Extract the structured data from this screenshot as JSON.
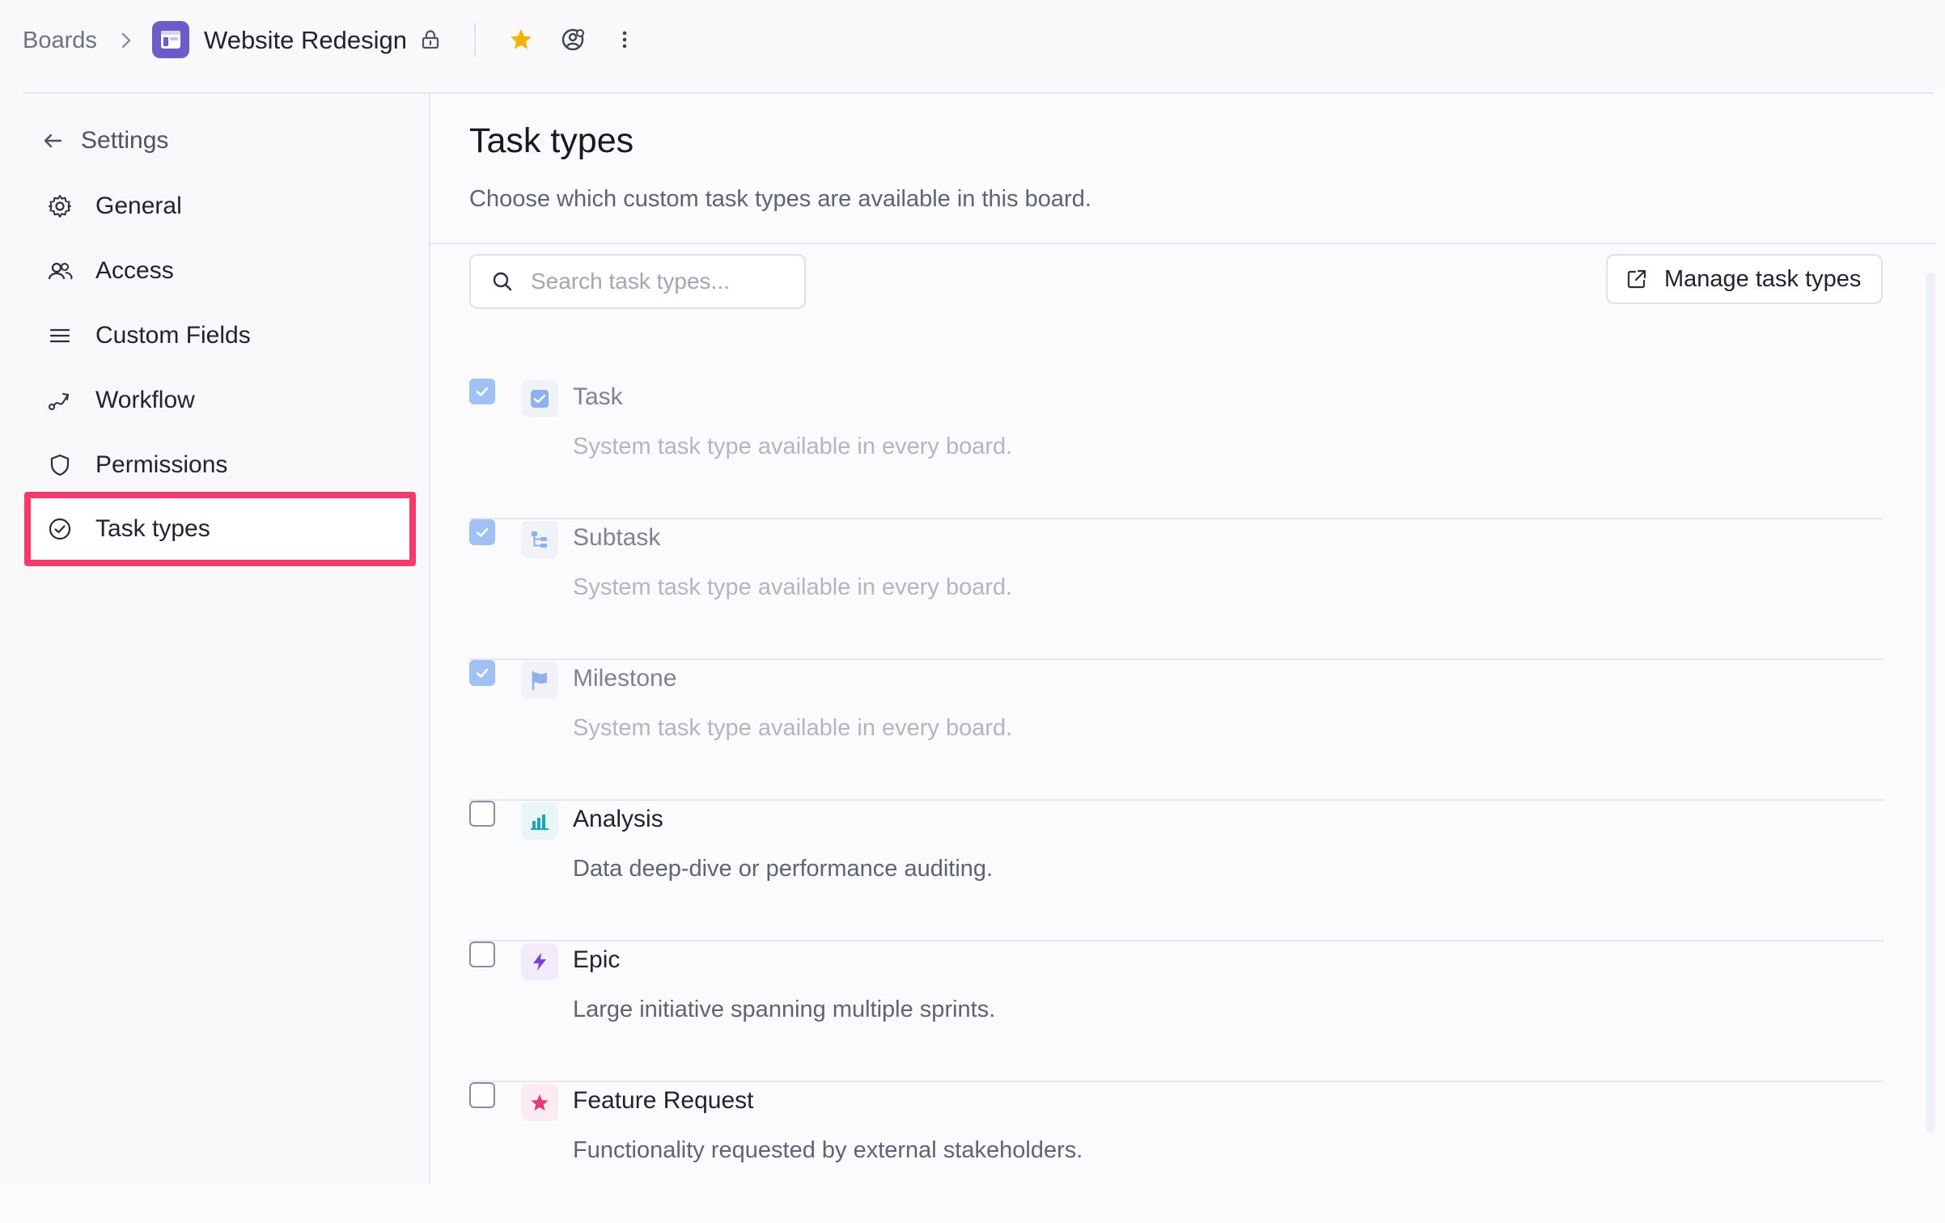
{
  "breadcrumb": {
    "root": "Boards",
    "board_title": "Website Redesign"
  },
  "icons": {
    "chevron": "chevron-right-icon",
    "board": "board-icon",
    "lock": "lock-icon",
    "star": "star-icon",
    "watch": "watch-icon",
    "more": "more-vertical-icon"
  },
  "colors": {
    "accent": "#6c5bc8",
    "highlight": "#f23a6f",
    "star": "#f5b400",
    "checked": "#9fc1f4"
  },
  "sidebar": {
    "back_label": "Settings",
    "items": [
      {
        "label": "General",
        "icon": "gear-icon"
      },
      {
        "label": "Access",
        "icon": "users-icon"
      },
      {
        "label": "Custom Fields",
        "icon": "list-icon"
      },
      {
        "label": "Workflow",
        "icon": "workflow-icon"
      },
      {
        "label": "Permissions",
        "icon": "shield-icon"
      },
      {
        "label": "Task types",
        "icon": "check-circle-icon",
        "active": true
      }
    ]
  },
  "main": {
    "title": "Task types",
    "subtitle": "Choose which custom task types are available in this board.",
    "search_placeholder": "Search task types...",
    "manage_button": "Manage task types"
  },
  "task_types": [
    {
      "name": "Task",
      "description": "System task type available in every board.",
      "checked": true,
      "system": true,
      "icon": "task-check-icon"
    },
    {
      "name": "Subtask",
      "description": "System task type available in every board.",
      "checked": true,
      "system": true,
      "icon": "subtask-icon"
    },
    {
      "name": "Milestone",
      "description": "System task type available in every board.",
      "checked": true,
      "system": true,
      "icon": "flag-icon"
    },
    {
      "name": "Analysis",
      "description": "Data deep-dive or performance auditing.",
      "checked": false,
      "system": false,
      "icon": "bar-chart-icon"
    },
    {
      "name": "Epic",
      "description": "Large initiative spanning multiple sprints.",
      "checked": false,
      "system": false,
      "icon": "lightning-icon"
    },
    {
      "name": "Feature Request",
      "description": "Functionality requested by external stakeholders.",
      "checked": false,
      "system": false,
      "icon": "star-icon"
    }
  ]
}
